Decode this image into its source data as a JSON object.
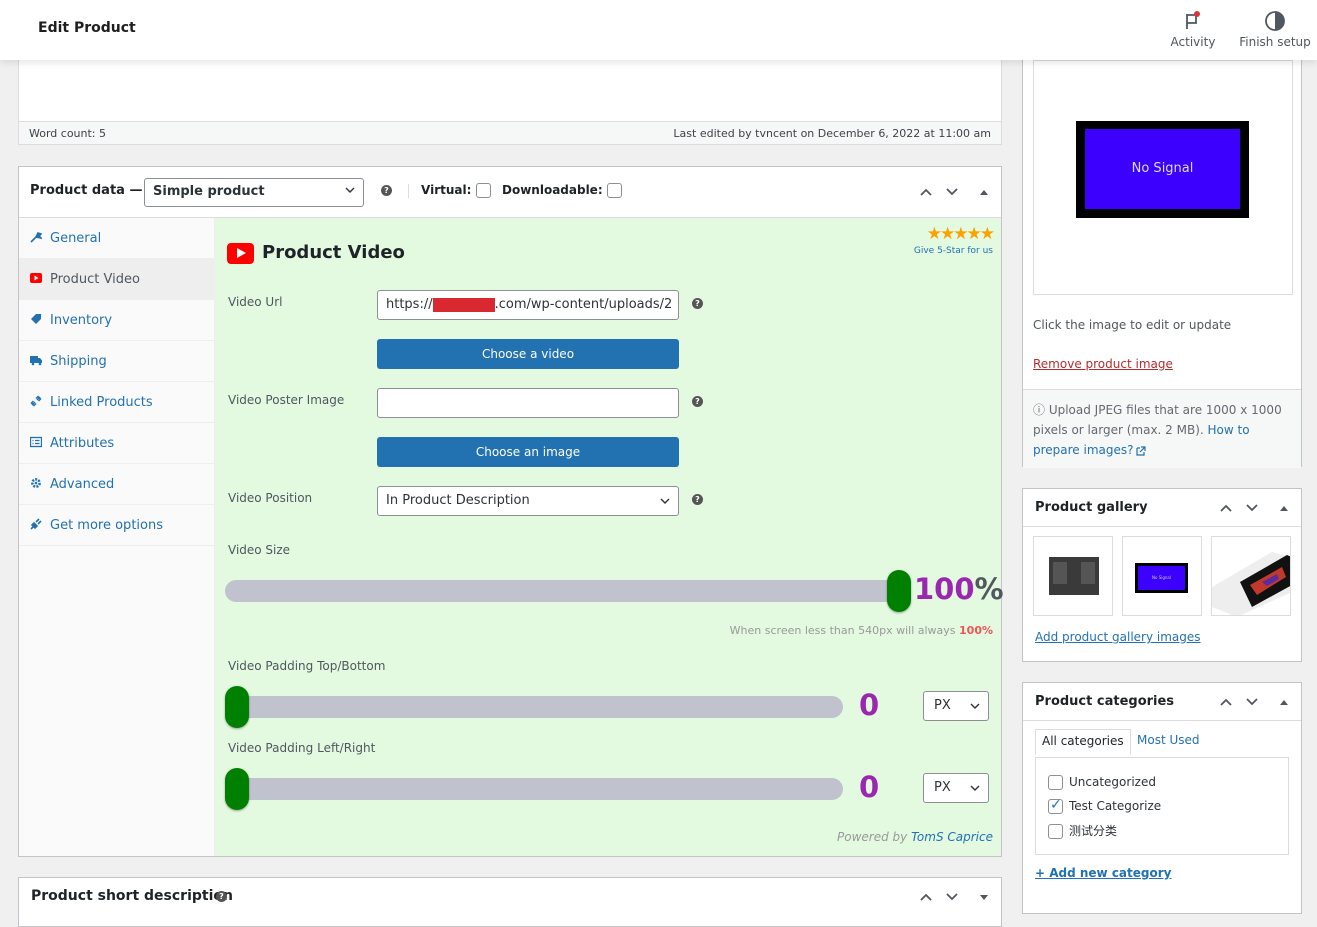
{
  "header": {
    "title": "Edit Product",
    "activity_label": "Activity",
    "finish_setup_label": "Finish setup"
  },
  "editor": {
    "word_count": "Word count: 5",
    "last_edited": "Last edited by tvncent on December 6, 2022 at 11:00 am"
  },
  "product_data": {
    "label": "Product data —",
    "type_selected": "Simple product",
    "virtual_label": "Virtual:",
    "downloadable_label": "Downloadable:",
    "virtual_checked": false,
    "downloadable_checked": false,
    "tabs": [
      {
        "label": "General",
        "icon": "wrench-icon"
      },
      {
        "label": "Product Video",
        "icon": "youtube-icon",
        "active": true
      },
      {
        "label": "Inventory",
        "icon": "tag-icon"
      },
      {
        "label": "Shipping",
        "icon": "truck-icon"
      },
      {
        "label": "Linked Products",
        "icon": "link-icon"
      },
      {
        "label": "Attributes",
        "icon": "list-icon"
      },
      {
        "label": "Advanced",
        "icon": "gear-icon"
      },
      {
        "label": "Get more options",
        "icon": "plugin-icon"
      }
    ]
  },
  "product_video": {
    "title": "Product Video",
    "rating_stars": "★★★★★",
    "rating_link": "Give 5-Star for us",
    "video_url_label": "Video Url",
    "video_url_prefix": "https://",
    "video_url_suffix": ".com/wp-content/uploads/2",
    "choose_video_label": "Choose a video",
    "poster_label": "Video Poster Image",
    "poster_value": "",
    "choose_image_label": "Choose an image",
    "position_label": "Video Position",
    "position_value": "In Product Description",
    "size_label": "Video Size",
    "size_value": "100",
    "size_unit": "%",
    "size_fraction": 1.0,
    "size_hint": "When screen less than 540px will always",
    "size_hint_value": "100%",
    "padding_tb_label": "Video Padding Top/Bottom",
    "padding_tb_value": "0",
    "padding_tb_fraction": 0,
    "padding_tb_unit": "PX",
    "padding_lr_label": "Video Padding Left/Right",
    "padding_lr_value": "0",
    "padding_lr_fraction": 0,
    "padding_lr_unit": "PX",
    "powered_by": "Powered by",
    "powered_by_name": "TomS Caprice"
  },
  "short_description": {
    "label": "Product short description"
  },
  "product_image": {
    "image_text": "No Signal",
    "click_hint": "Click the image to edit or update",
    "remove_label": "Remove product image",
    "upload_note": "ⓘ Upload JPEG files that are 1000 x 1000 pixels or larger (max. 2 MB).",
    "how_to_link": "How to prepare images?"
  },
  "product_gallery": {
    "title": "Product gallery",
    "thumb_2_text": "No Signal",
    "add_label": "Add product gallery images"
  },
  "product_categories": {
    "title": "Product categories",
    "tab_all": "All categories",
    "tab_most_used": "Most Used",
    "items": [
      {
        "label": "Uncategorized",
        "checked": false
      },
      {
        "label": "Test Categorize",
        "checked": true
      },
      {
        "label": "测试分类",
        "checked": false
      }
    ],
    "add_label": "+ Add new category"
  },
  "colors": {
    "accent": "#2271b1",
    "panel_bg": "#e3fae1",
    "slider_knob": "#008000",
    "value_purple": "#9b27b0",
    "remove_red": "#b32d2e"
  }
}
